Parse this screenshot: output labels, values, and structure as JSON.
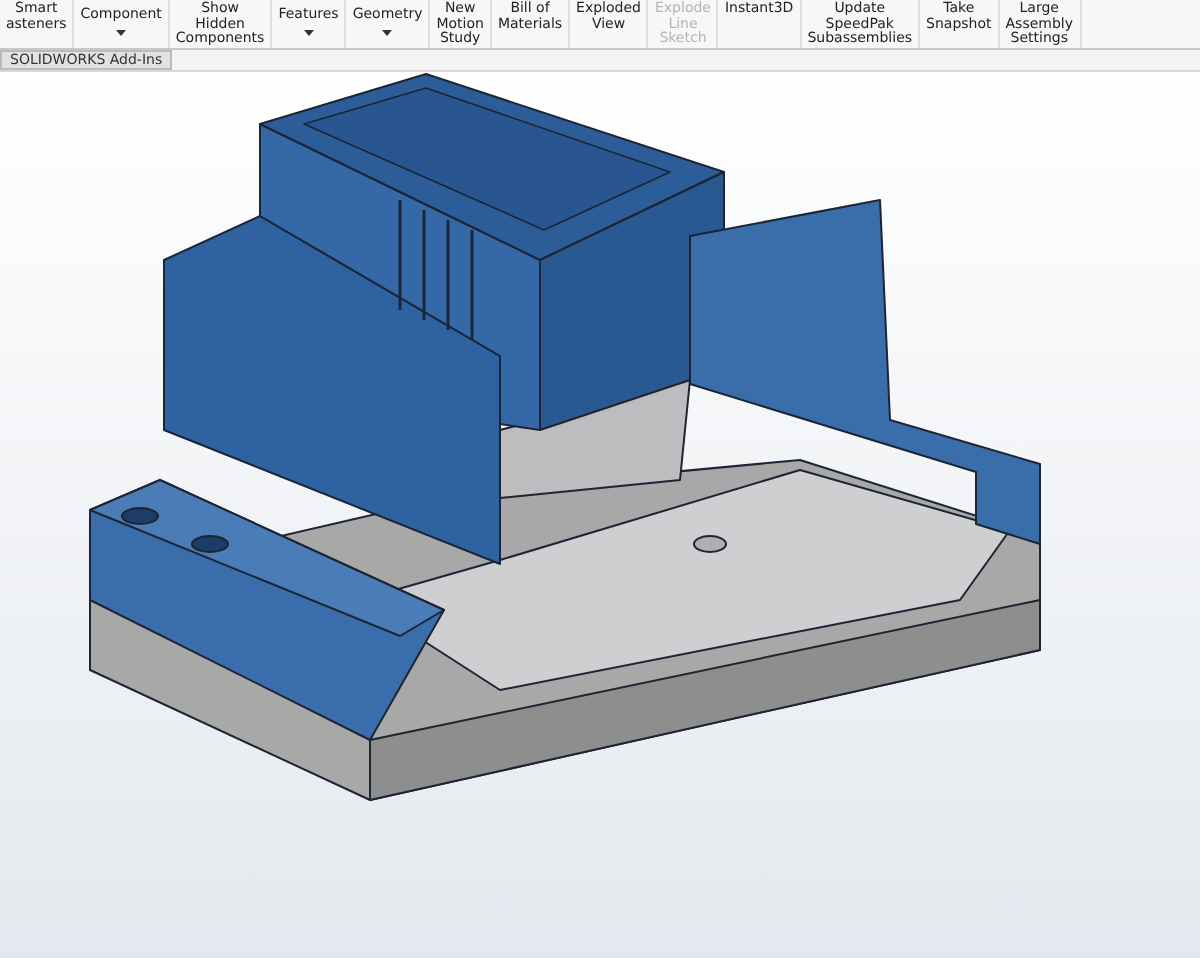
{
  "toolbar": {
    "buttons": [
      {
        "kind": "plain",
        "lines": [
          "Smart",
          "asteners"
        ],
        "disabled": false
      },
      {
        "kind": "dropdown",
        "lines": [
          "Component"
        ],
        "disabled": false
      },
      {
        "kind": "plain",
        "lines": [
          "Show",
          "Hidden",
          "Components"
        ],
        "disabled": false
      },
      {
        "kind": "dropdown",
        "lines": [
          "Features"
        ],
        "disabled": false
      },
      {
        "kind": "dropdown",
        "lines": [
          "Geometry"
        ],
        "disabled": false
      },
      {
        "kind": "plain",
        "lines": [
          "New",
          "Motion",
          "Study"
        ],
        "disabled": false
      },
      {
        "kind": "plain",
        "lines": [
          "Bill of",
          "Materials"
        ],
        "disabled": false
      },
      {
        "kind": "plain",
        "lines": [
          "Exploded",
          "View"
        ],
        "disabled": false
      },
      {
        "kind": "plain",
        "lines": [
          "Explode",
          "Line",
          "Sketch"
        ],
        "disabled": true
      },
      {
        "kind": "plain",
        "lines": [
          "Instant3D"
        ],
        "disabled": false
      },
      {
        "kind": "plain",
        "lines": [
          "Update",
          "SpeedPak",
          "Subassemblies"
        ],
        "disabled": false
      },
      {
        "kind": "plain",
        "lines": [
          "Take",
          "Snapshot"
        ],
        "disabled": false
      },
      {
        "kind": "plain",
        "lines": [
          "Large",
          "Assembly",
          "Settings"
        ],
        "disabled": false
      }
    ]
  },
  "tabs": [
    {
      "label": "SOLIDWORKS Add-Ins",
      "selected": true
    }
  ]
}
